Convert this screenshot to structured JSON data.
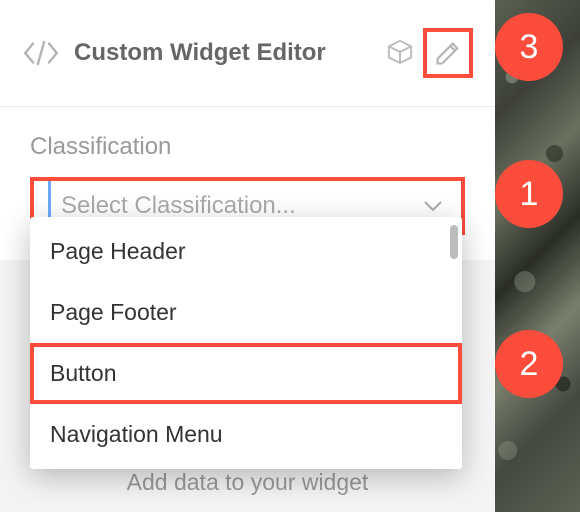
{
  "header": {
    "title": "Custom Widget Editor"
  },
  "classification": {
    "label": "Classification",
    "placeholder": "Select Classification...",
    "options": [
      {
        "label": "Page Header",
        "highlighted": false
      },
      {
        "label": "Page Footer",
        "highlighted": false
      },
      {
        "label": "Button",
        "highlighted": true
      },
      {
        "label": "Navigation Menu",
        "highlighted": false
      }
    ]
  },
  "bottom": {
    "prompt": "Add data to your widget"
  },
  "markers": {
    "m1": "1",
    "m2": "2",
    "m3": "3"
  },
  "colors": {
    "accent": "#fc4c3c"
  }
}
